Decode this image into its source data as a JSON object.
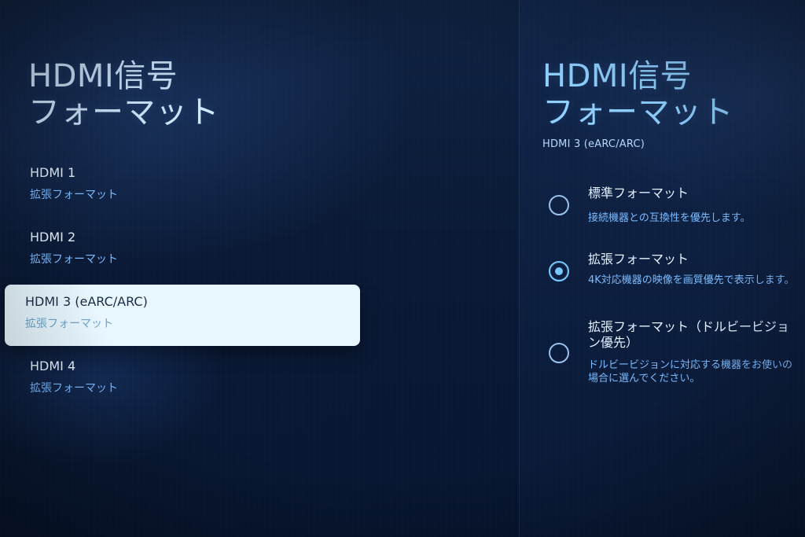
{
  "screen": {
    "left_title_lines": [
      "HDMI信号",
      "フォーマット"
    ],
    "right_title_lines": [
      "HDMI信号",
      "フォーマット"
    ],
    "right_subtitle": "HDMI 3 (eARC/ARC)",
    "colors": {
      "background": "#0b1a33",
      "accent_blue": "#7bbcff",
      "selected_item_bg": "#e7f6ff"
    }
  },
  "hdmi_inputs": [
    {
      "name": "HDMI 1",
      "format": "拡張フォーマット",
      "selected": false
    },
    {
      "name": "HDMI 2",
      "format": "拡張フォーマット",
      "selected": false
    },
    {
      "name": "HDMI 3 (eARC/ARC)",
      "format": "拡張フォーマット",
      "selected": true
    },
    {
      "name": "HDMI 4",
      "format": "拡張フォーマット",
      "selected": false
    }
  ],
  "format_options": [
    {
      "title": "標準フォーマット",
      "description": "接続機器との互換性を優先します。",
      "checked": false
    },
    {
      "title": "拡張フォーマット",
      "description": "4K対応機器の映像を画質優先で表示します。",
      "checked": true
    },
    {
      "title": "拡張フォーマット（ドルビービジョン優先）",
      "description": "ドルビービジョンに対応する機器をお使いの場合に選んでください。",
      "checked": false
    }
  ],
  "icons": {
    "radio_unchecked": "radio-unchecked-icon",
    "radio_checked": "radio-checked-icon"
  }
}
